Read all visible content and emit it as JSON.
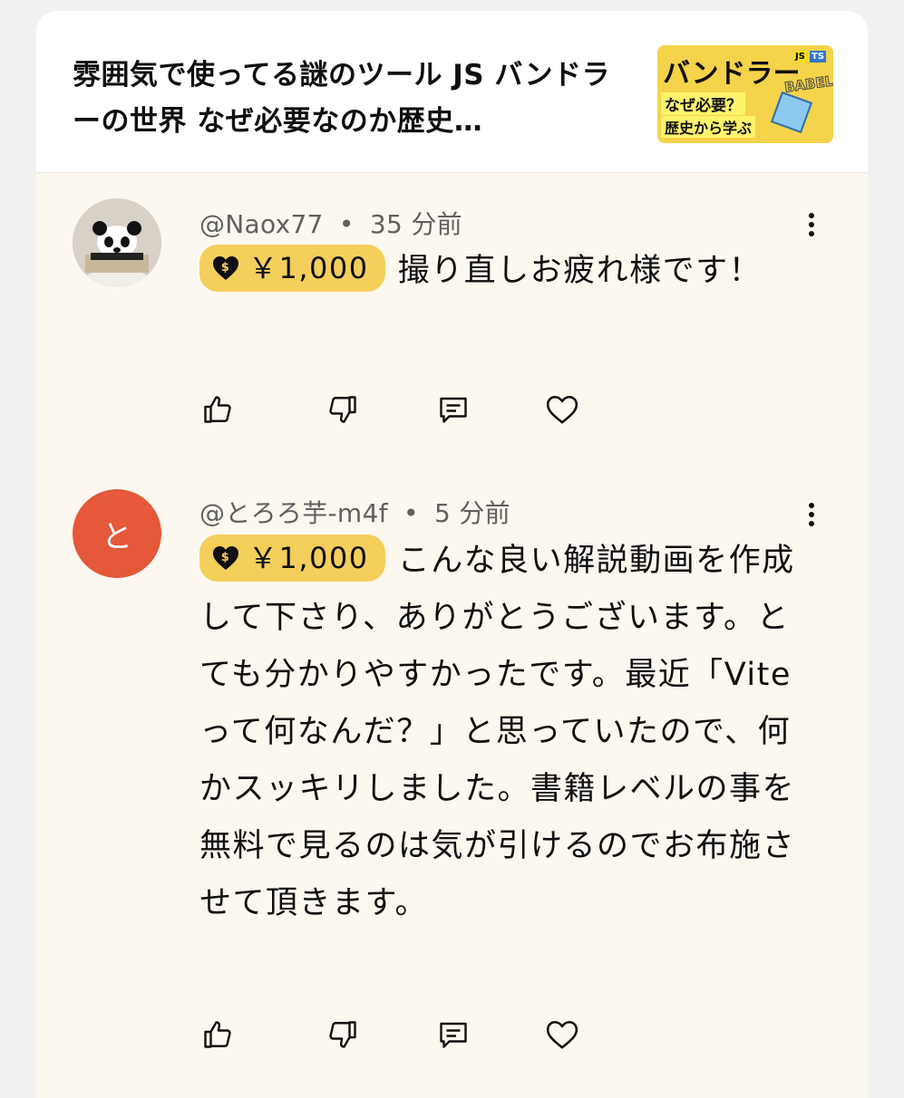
{
  "video": {
    "title": "雰囲気で使ってる謎のツール JS バンドラーの世界 なぜ必要なのか歴史…",
    "thumbnail": {
      "headline": "バンドラー",
      "line2": "なぜ必要？",
      "line3": "歴史から学ぶ",
      "badge_js": "JS",
      "badge_ts": "TS",
      "badge_babel": "BABEL"
    }
  },
  "comments": [
    {
      "author": "@Naox77",
      "time": "35 分前",
      "separator": "•",
      "amount": "￥1,000",
      "text": "撮り直しお疲れ様です！",
      "avatar": "panda-photo"
    },
    {
      "author": "@とろろ芋-m4f",
      "time": "5 分前",
      "separator": "•",
      "amount": "￥1,000",
      "text": "こんな良い解説動画を作成して下さり、ありがとうございます。とても分かりやすかったです。最近「Viteって何なんだ？」と思っていたので、何かスッキリしました。書籍レベルの事を無料で見るのは気が引けるのでお布施させて頂きます。",
      "avatar_letter": "と",
      "avatar_color": "#e5583a"
    }
  ],
  "colors": {
    "chip": "#f5cf5b",
    "card_bg": "#fcf8ef",
    "meta": "#606060"
  },
  "icons": [
    "thumbs-up-icon",
    "thumbs-down-icon",
    "reply-icon",
    "heart-icon",
    "more-vert-icon",
    "dollar-heart-icon"
  ]
}
